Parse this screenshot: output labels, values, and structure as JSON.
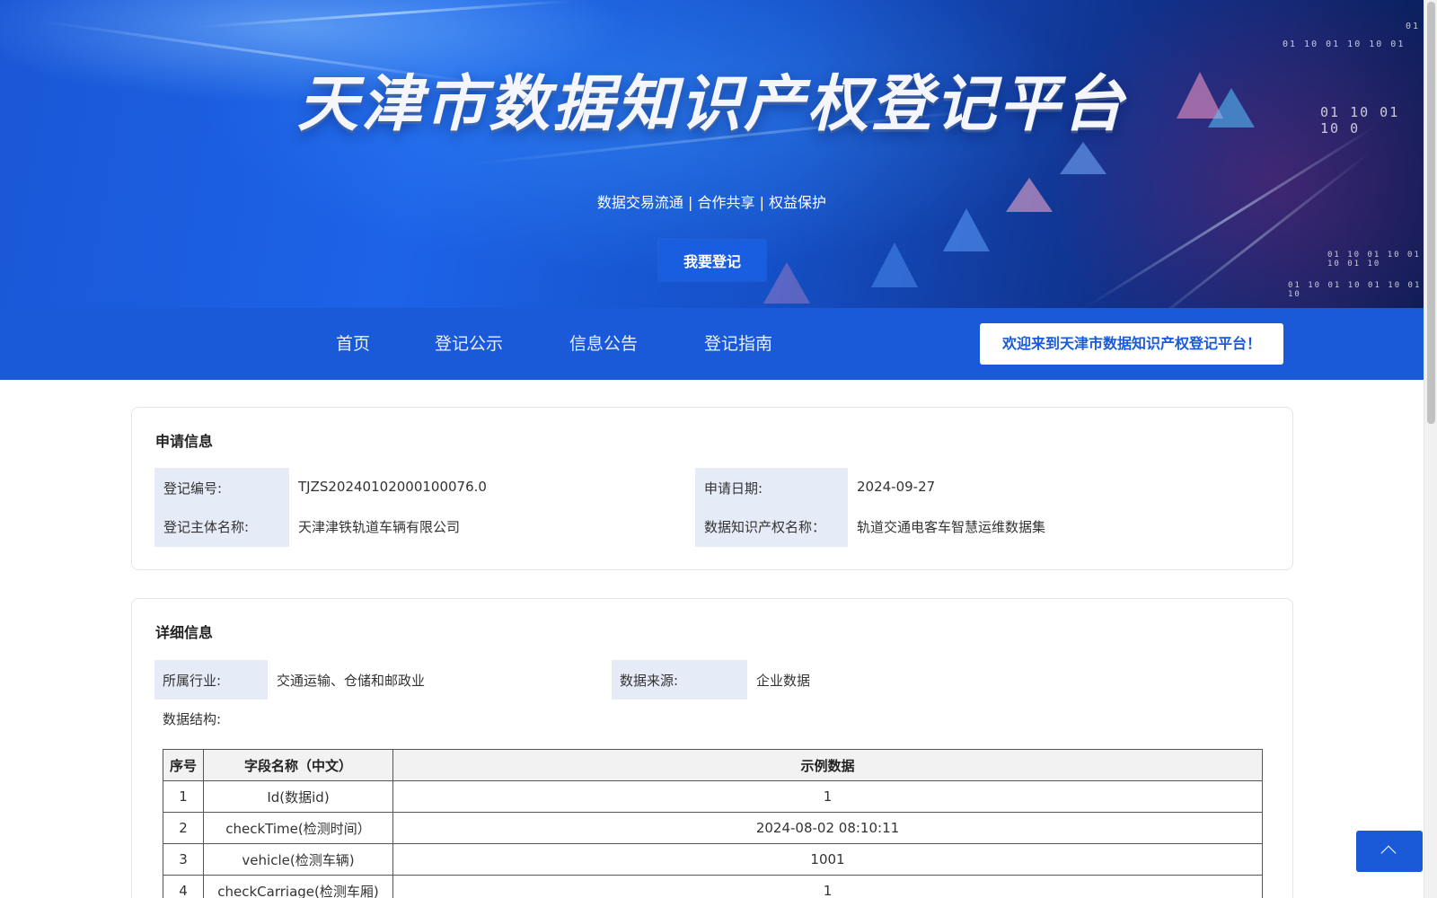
{
  "hero": {
    "title": "天津市数据知识产权登记平台",
    "subtitle": "数据交易流通 | 合作共享 | 权益保护",
    "register_button": "我要登记",
    "decor_bits": [
      "01 10 01 10 10 01",
      "01 10 01 10 0",
      "01 10 01 10 01 10 01 10",
      "01 10 01 10 01 10 01 10",
      "01"
    ]
  },
  "nav": {
    "items": [
      "首页",
      "登记公示",
      "信息公告",
      "登记指南"
    ],
    "welcome": "欢迎来到天津市数据知识产权登记平台！"
  },
  "application_info": {
    "title": "申请信息",
    "reg_no_label": "登记编号:",
    "reg_no_value": "TJZS20240102000100076.0",
    "apply_date_label": "申请日期:",
    "apply_date_value": "2024-09-27",
    "subject_label": "登记主体名称:",
    "subject_value": "天津津铁轨道车辆有限公司",
    "ip_name_label": "数据知识产权名称：",
    "ip_name_value": "轨道交通电客车智慧运维数据集"
  },
  "detail_info": {
    "title": "详细信息",
    "industry_label": "所属行业:",
    "industry_value": "交通运输、仓储和邮政业",
    "source_label": "数据来源:",
    "source_value": "企业数据",
    "structure_label": "数据结构:",
    "table": {
      "headers": [
        "序号",
        "字段名称（中文）",
        "示例数据"
      ],
      "rows": [
        [
          "1",
          "Id(数据id)",
          "1"
        ],
        [
          "2",
          "checkTime(检测时间）",
          "2024-08-02 08:10:11"
        ],
        [
          "3",
          "vehicle(检测车辆)",
          "1001"
        ],
        [
          "4",
          "checkCarriage(检测车厢)",
          "1"
        ]
      ]
    }
  },
  "colors": {
    "primary": "#1a5ad9",
    "label_bg": "#e6ecf7"
  },
  "icons": {
    "back_to_top": "chevron-up-icon"
  }
}
